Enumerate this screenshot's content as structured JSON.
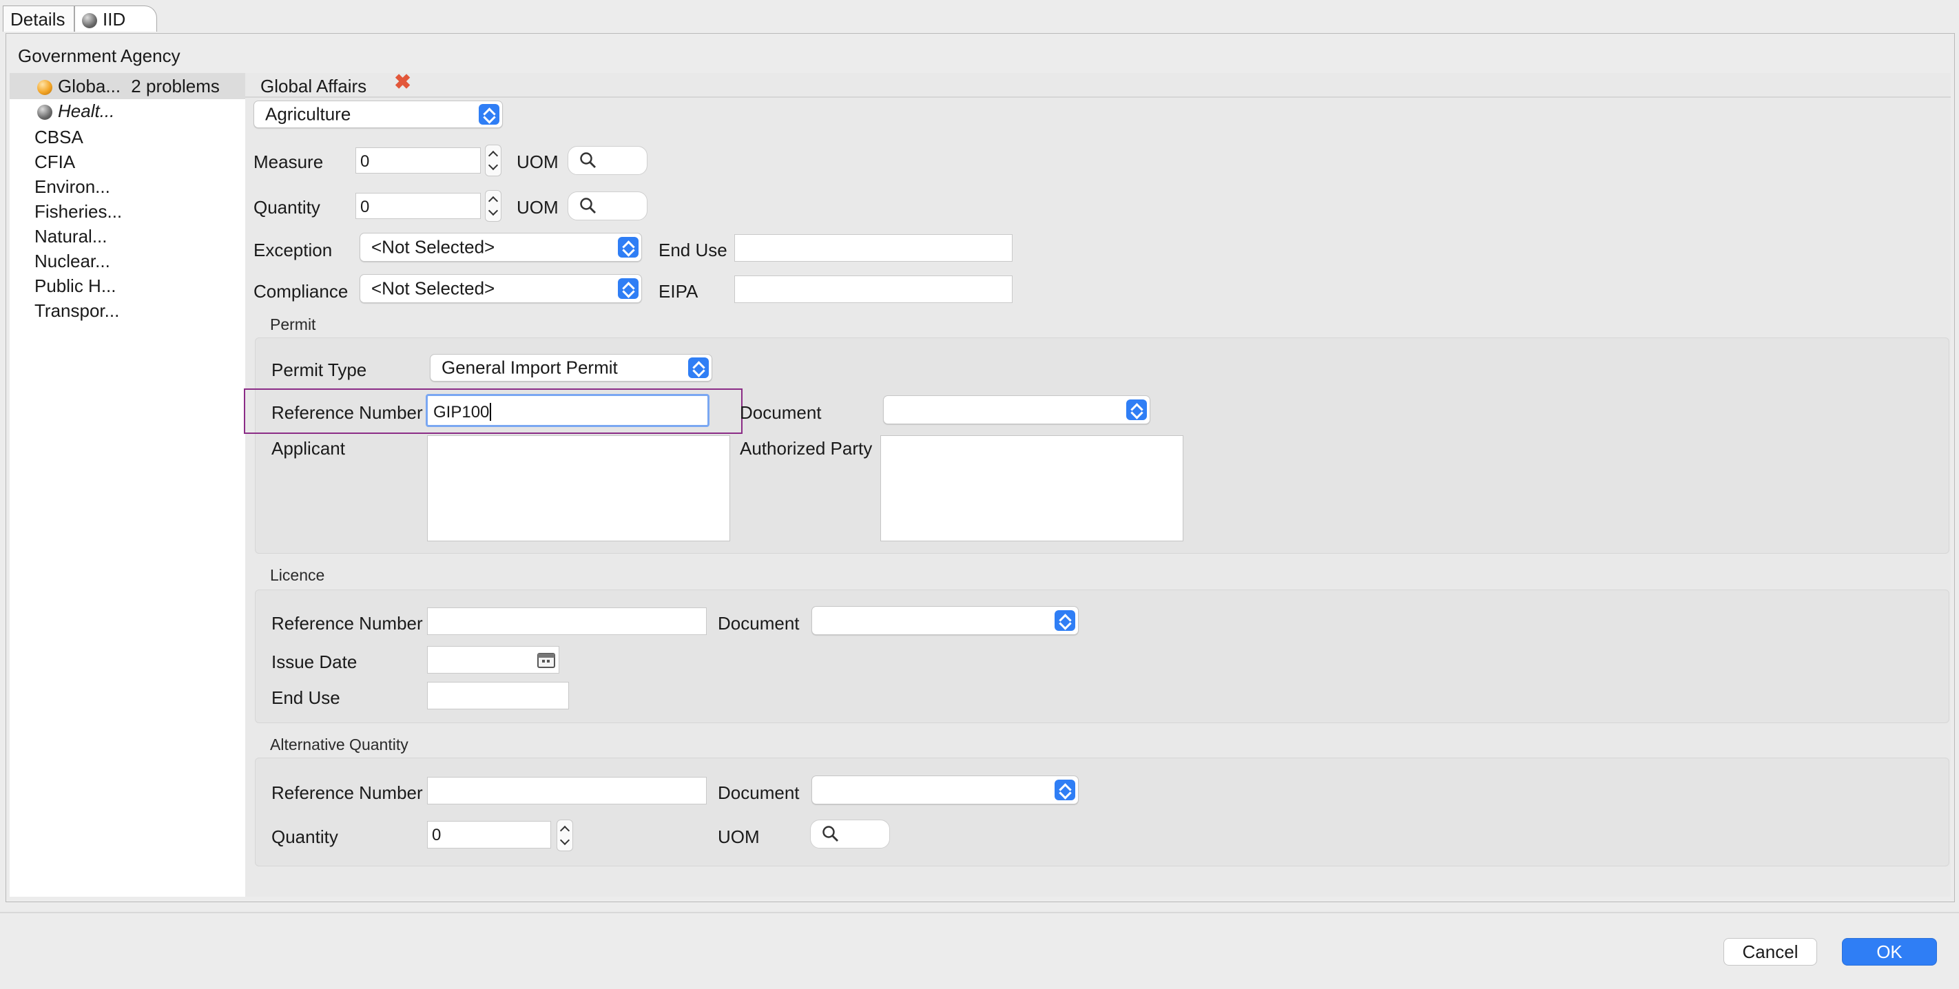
{
  "tabs": [
    {
      "label": "Details",
      "active": false
    },
    {
      "label": "IID",
      "active": true,
      "icon": "gem-icon"
    }
  ],
  "sidebar": {
    "heading": "Government Agency",
    "items": [
      {
        "label": "Globa...",
        "badge": "2 problems",
        "icon": "warning-gem-icon",
        "selected": true
      },
      {
        "label": "Healt...",
        "icon": "gem-icon",
        "italic": true
      },
      {
        "label": "CBSA"
      },
      {
        "label": "CFIA"
      },
      {
        "label": "Environ..."
      },
      {
        "label": "Fisheries..."
      },
      {
        "label": "Natural..."
      },
      {
        "label": "Nuclear..."
      },
      {
        "label": "Public H..."
      },
      {
        "label": "Transpor..."
      }
    ]
  },
  "main": {
    "title": "Global Affairs",
    "remove_icon": "close-x-icon",
    "category_select": "Agriculture",
    "measure": {
      "label": "Measure",
      "value": "0",
      "uom_label": "UOM"
    },
    "quantity": {
      "label": "Quantity",
      "value": "0",
      "uom_label": "UOM"
    },
    "exception": {
      "label": "Exception",
      "value": "<Not Selected>"
    },
    "end_use": {
      "label": "End Use",
      "value": ""
    },
    "compliance": {
      "label": "Compliance",
      "value": "<Not Selected>"
    },
    "eipa": {
      "label": "EIPA",
      "value": ""
    }
  },
  "permit": {
    "group_label": "Permit",
    "permit_type_label": "Permit Type",
    "permit_type_value": "General Import Permit",
    "reference_label": "Reference Number",
    "reference_value": "GIP100",
    "document_label": "Document",
    "document_value": "",
    "applicant_label": "Applicant",
    "authorized_label": "Authorized Party"
  },
  "licence": {
    "group_label": "Licence",
    "reference_label": "Reference Number",
    "reference_value": "",
    "document_label": "Document",
    "issue_date_label": "Issue Date",
    "end_use_label": "End Use"
  },
  "alt_quantity": {
    "group_label": "Alternative Quantity",
    "reference_label": "Reference Number",
    "reference_value": "",
    "document_label": "Document",
    "quantity_label": "Quantity",
    "quantity_value": "0",
    "uom_label": "UOM"
  },
  "footer": {
    "cancel_label": "Cancel",
    "ok_label": "OK"
  },
  "colors": {
    "accent": "#2f7ef5",
    "highlight_border": "#8b2c86",
    "warning": "#f3a526"
  }
}
